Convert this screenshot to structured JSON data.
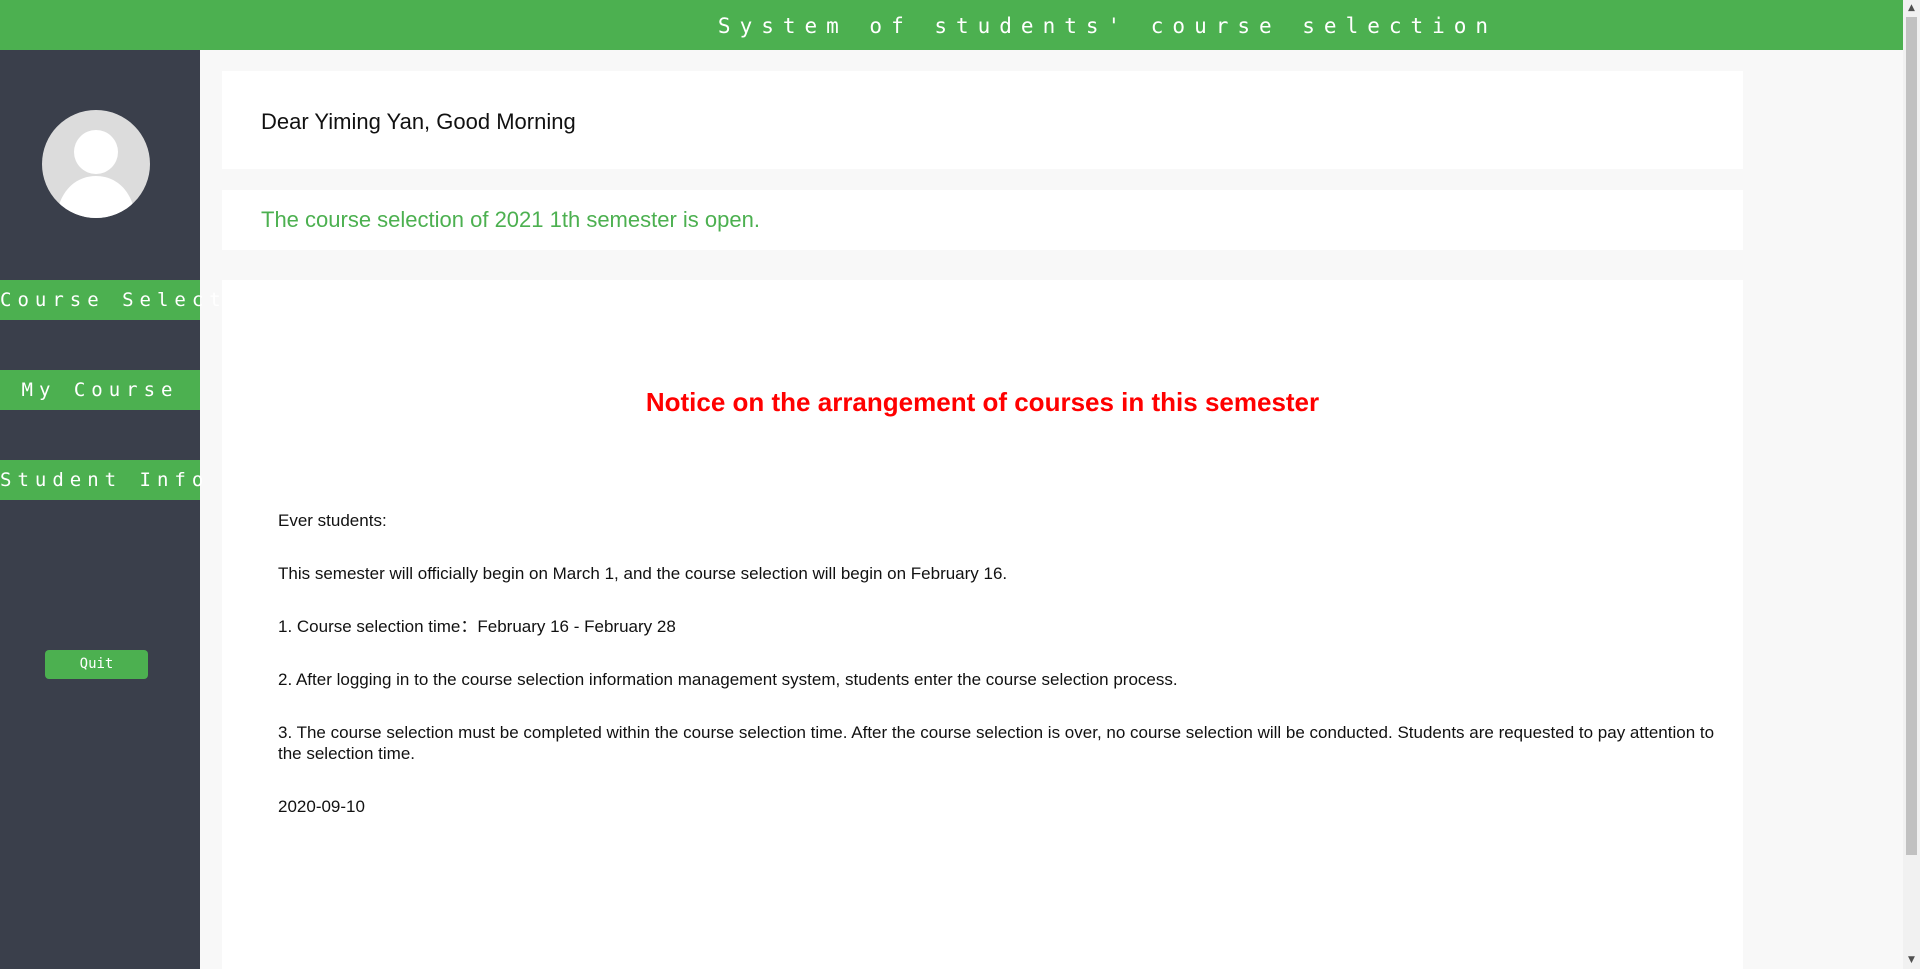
{
  "header": {
    "title": "System of students' course selection"
  },
  "sidebar": {
    "avatar_icon": "user-avatar-icon",
    "nav": [
      {
        "label": "Course Select"
      },
      {
        "label": "My Course"
      },
      {
        "label": "Student Info"
      }
    ],
    "quit_label": "Quit"
  },
  "greeting": "Dear Yiming Yan, Good Morning",
  "status_message": "The course selection of 2021 1th semester is open.",
  "notice": {
    "title": "Notice on the arrangement of courses in this semester",
    "salutation": "Ever students:",
    "intro": "This semester will officially begin on March 1, and the course selection will begin on February 16.",
    "items": [
      "1. Course selection time：February 16 - February 28",
      "2. After logging in to the course selection information management system, students enter the course selection process.",
      "3. The course selection must be completed within the course selection time. After the course selection is over, no course selection will be conducted. Students are requested to pay attention to the selection time."
    ],
    "date": "2020-09-10"
  },
  "colors": {
    "accent": "#4cb050",
    "sidebar_bg": "#3a3f4b",
    "notice_title": "#ff0000"
  }
}
